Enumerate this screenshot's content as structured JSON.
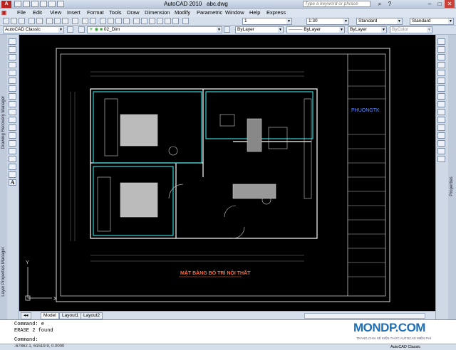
{
  "window": {
    "title": "AutoCAD 2010",
    "filename": "abc.dwg",
    "search_placeholder": "Type a keyword or phrase"
  },
  "menu": [
    "File",
    "Edit",
    "View",
    "Insert",
    "Format",
    "Tools",
    "Draw",
    "Dimension",
    "Modify",
    "Parametric",
    "Window",
    "Help",
    "Express"
  ],
  "toolbar1": {
    "layer_value": "1",
    "scale_value": "1:30",
    "text_style": "Standard",
    "dim_style": "Standard"
  },
  "toolbar2": {
    "workspace": "AutoCAD Classic",
    "layer_name": "02_Dim",
    "color": "ByLayer",
    "linetype": "ByLayer",
    "lineweight": "ByLayer",
    "plotstyle": "ByColor"
  },
  "palettes": {
    "left_top": "Drawing Recovery Manager",
    "left_bottom": "Layer Properties Manager",
    "right": "Properties"
  },
  "drawing": {
    "title": "MẶT BẰNG BỐ TRÍ NỘI THẤT",
    "company": "PHUONGTK",
    "axis_y": "Y",
    "axis_x": "X"
  },
  "layout_tabs": [
    "Model",
    "Layout1",
    "Layout2"
  ],
  "command": {
    "lines": [
      "Command: e",
      "ERASE 2 found"
    ],
    "prompt": "Command:"
  },
  "status": {
    "coords": "-67862.1, 61519.9, 0.0000",
    "workspace": "AutoCAD Classic"
  },
  "brand": {
    "name": "MONDP.COM",
    "tagline": "TRANG CHIA SẺ KIẾN THỨC AUTOCAD MIỄN PHÍ"
  }
}
